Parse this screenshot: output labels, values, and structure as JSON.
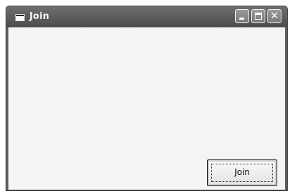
{
  "window": {
    "title": "Join",
    "icon": "form-window-icon",
    "controls": {
      "minimize_icon": "minimize-icon",
      "maximize_icon": "maximize-icon",
      "close_icon": "close-icon",
      "close_glyph": "✕"
    }
  },
  "form": {
    "join_button": {
      "label_mnemonic": "J",
      "label_rest": "oin"
    }
  }
}
